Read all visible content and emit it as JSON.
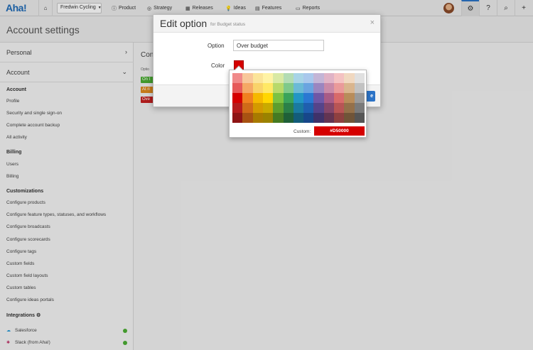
{
  "nav": {
    "logo": "Aha!",
    "workspace": "Fredwin Cycling",
    "items": [
      {
        "label": "Product",
        "icon": "info-circle-icon",
        "glyph": "ⓘ"
      },
      {
        "label": "Strategy",
        "icon": "target-icon",
        "glyph": "◎"
      },
      {
        "label": "Releases",
        "icon": "calendar-icon",
        "glyph": "▦"
      },
      {
        "label": "Ideas",
        "icon": "lightbulb-icon",
        "glyph": "💡"
      },
      {
        "label": "Features",
        "icon": "grid-icon",
        "glyph": "▤"
      },
      {
        "label": "Reports",
        "icon": "document-icon",
        "glyph": "▭"
      }
    ]
  },
  "page": {
    "title": "Account settings"
  },
  "sidebar": {
    "sections": [
      "Personal",
      "Account"
    ],
    "groups": {
      "account": "Account",
      "billing": "Billing",
      "customizations": "Customizations",
      "integrations": "Integrations"
    },
    "account_links": [
      "Profile",
      "Security and single sign-on",
      "Complete account backup",
      "All activity"
    ],
    "billing_links": [
      "Users",
      "Billing"
    ],
    "customization_links": [
      "Configure products",
      "Configure feature types, statuses, and workflows",
      "Configure broadcasts",
      "Configure scorecards",
      "Configure tags",
      "Custom fields",
      "Custom field layouts",
      "Custom tables",
      "Configure ideas portals"
    ],
    "integration_links": [
      "Salesforce",
      "Slack (from Aha!)"
    ]
  },
  "background": {
    "heading": "Con",
    "sub": "Optio",
    "tags": [
      {
        "label": "On t",
        "color": "#4caf34"
      },
      {
        "label": "At ri",
        "color": "#e08a1e"
      },
      {
        "label": "Ove",
        "color": "#c62020"
      }
    ]
  },
  "modal": {
    "title": "Edit option",
    "subtitle": "for Budget status",
    "close": "×",
    "option_label": "Option",
    "option_value": "Over budget",
    "color_label": "Color",
    "save_label": "e"
  },
  "picker": {
    "custom_label": "Custom:",
    "custom_value": "#D50000",
    "colors": [
      [
        "#f08a8a",
        "#f8c79a",
        "#fbe49a",
        "#fff3a6",
        "#d9e9a4",
        "#b3dcb3",
        "#a8d4e6",
        "#a9c8ec",
        "#c3b5d6",
        "#e0b3c6",
        "#f4c2c2",
        "#f0d8c0",
        "#e0e0e0"
      ],
      [
        "#e65a5a",
        "#f5a865",
        "#f9d36a",
        "#ffe866",
        "#b8d96a",
        "#7fc98a",
        "#6bbad6",
        "#6aa4e0",
        "#9a86c0",
        "#c98aa8",
        "#ea9a9a",
        "#d9b58e",
        "#c2c2c2"
      ],
      [
        "#d50000",
        "#f08020",
        "#f5b800",
        "#ffd600",
        "#7cc242",
        "#3aa35a",
        "#2296c4",
        "#2a78d2",
        "#6e57a6",
        "#a85b86",
        "#d86a6a",
        "#b88c5a",
        "#9a9a9a"
      ],
      [
        "#b51c1c",
        "#d06a18",
        "#d49a00",
        "#c9aa00",
        "#5e9e2e",
        "#2b8048",
        "#1a7aa0",
        "#1f5fae",
        "#55448a",
        "#84466a",
        "#b85555",
        "#94704a",
        "#7a7a7a"
      ],
      [
        "#8e1414",
        "#a85212",
        "#a87a00",
        "#9a8200",
        "#457a22",
        "#1f6038",
        "#135c7a",
        "#17478a",
        "#3f326a",
        "#633452",
        "#8e4040",
        "#705438",
        "#555555"
      ]
    ]
  }
}
